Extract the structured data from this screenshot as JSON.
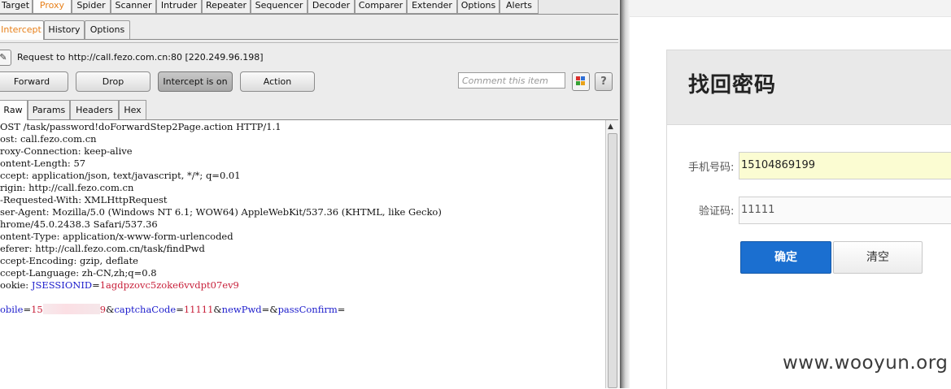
{
  "burp": {
    "top_tabs": [
      "Target",
      "Proxy",
      "Spider",
      "Scanner",
      "Intruder",
      "Repeater",
      "Sequencer",
      "Decoder",
      "Comparer",
      "Extender",
      "Options",
      "Alerts"
    ],
    "proxy_tabs": [
      "Intercept",
      "History",
      "Options"
    ],
    "request_label": "Request to http://call.fezo.com.cn:80  [220.249.96.198]",
    "buttons": {
      "forward": "Forward",
      "drop": "Drop",
      "intercept": "Intercept is on",
      "action": "Action"
    },
    "comment_placeholder": "Comment this item",
    "help_symbol": "?",
    "view_tabs": [
      "Raw",
      "Params",
      "Headers",
      "Hex"
    ],
    "request_lines": [
      "OST /task/password!doForwardStep2Page.action HTTP/1.1",
      "ost: call.fezo.com.cn",
      "roxy-Connection: keep-alive",
      "ontent-Length: 57",
      "ccept: application/json, text/javascript, */*; q=0.01",
      "rigin: http://call.fezo.com.cn",
      "-Requested-With: XMLHttpRequest",
      "ser-Agent: Mozilla/5.0 (Windows NT 6.1; WOW64) AppleWebKit/537.36 (KHTML, like Gecko)",
      "hrome/45.0.2438.3 Safari/537.36",
      "ontent-Type: application/x-www-form-urlencoded",
      "eferer: http://call.fezo.com.cn/task/findPwd",
      "ccept-Encoding: gzip, deflate",
      "ccept-Language: zh-CN,zh;q=0.8"
    ],
    "cookie": {
      "prefix": "ookie: ",
      "name": "JSESSIONID",
      "eq": "=",
      "value": "1agdpzovc5zoke6vvdpt07ev9"
    },
    "body": {
      "k1": "obile",
      "eq": "=",
      "v1_start": "15",
      "v1_end": "9",
      "amp": "&",
      "k2": "captchaCode",
      "v2": "11111",
      "k3": "newPwd",
      "k4": "passConfirm"
    }
  },
  "web": {
    "title": "找回密码",
    "phone_label": "手机号码:",
    "phone_value": "15104869199",
    "code_label": "验证码:",
    "code_value": "11111",
    "confirm_button": "确定",
    "clear_button": "清空",
    "watermark": "www.wooyun.org"
  },
  "colors": {
    "accent_orange": "#e8801a",
    "param_blue": "#1c1ccc",
    "value_red": "#c8203a",
    "primary_button": "#1b6fd0",
    "input_highlight": "#fbfcd2"
  }
}
